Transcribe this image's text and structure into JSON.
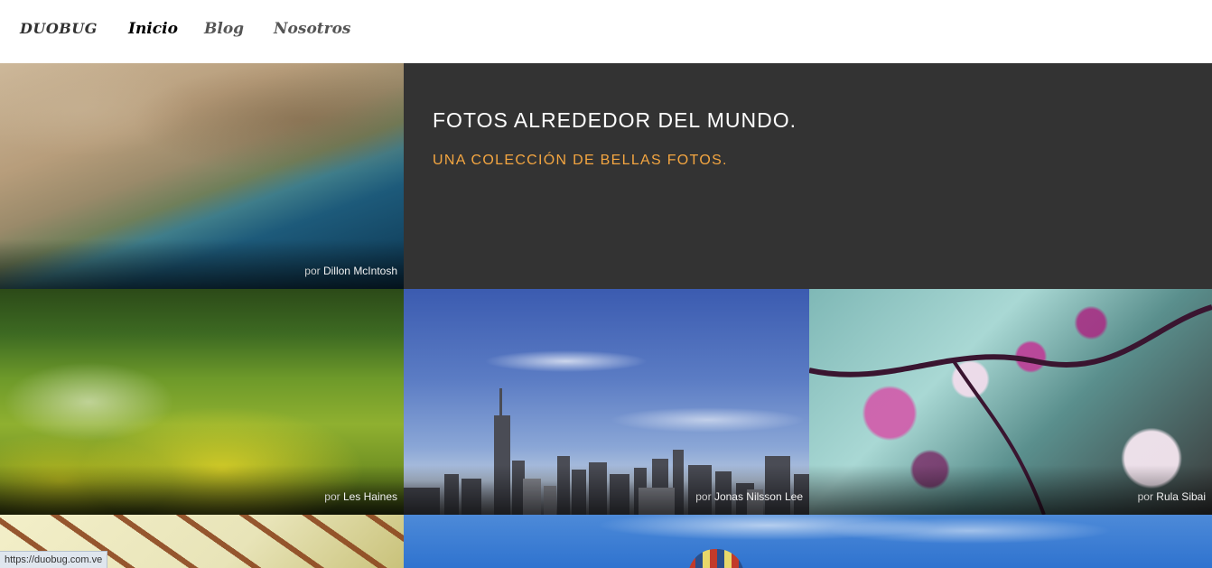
{
  "nav": {
    "brand": "DUOBUG",
    "items": [
      {
        "label": "Inicio",
        "active": true
      },
      {
        "label": "Blog",
        "active": false
      },
      {
        "label": "Nosotros",
        "active": false
      }
    ]
  },
  "hero": {
    "title": "FOTOS ALREDEDOR DEL MUNDO.",
    "subtitle": "UNA COLECCIÓN DE BELLAS FOTOS.",
    "panel_color": "#333333",
    "accent_color": "#f4a641"
  },
  "photos": [
    {
      "prefix": "por",
      "author": "Dillon McIntosh"
    },
    {
      "prefix": "por",
      "author": "Les Haines"
    },
    {
      "prefix": "por",
      "author": "Jonas Nilsson Lee"
    },
    {
      "prefix": "por",
      "author": "Rula Sibai"
    }
  ],
  "status_bar": {
    "url": "https://duobug.com.ve"
  }
}
